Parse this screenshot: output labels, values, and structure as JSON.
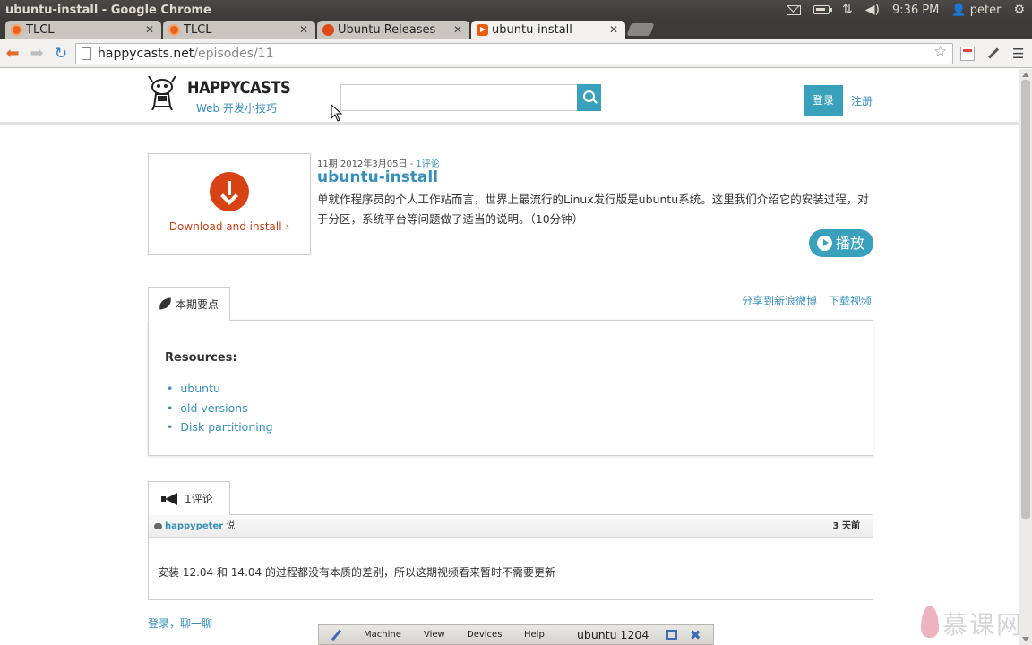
{
  "panel": {
    "window_title": "ubuntu-install - Google Chrome",
    "clock": "9:36 PM",
    "user": "peter"
  },
  "tabs": [
    {
      "label": "TLCL",
      "favicon": "tlcl-icon"
    },
    {
      "label": "TLCL",
      "favicon": "tlcl-icon"
    },
    {
      "label": "Ubuntu Releases",
      "favicon": "ubuntu-icon"
    },
    {
      "label": "ubuntu-install",
      "favicon": "video-icon",
      "active": true
    }
  ],
  "toolbar": {
    "url_domain": "happycasts.net",
    "url_path": "/episodes/11"
  },
  "site": {
    "logo_name": "HAPPYCASTS",
    "logo_tagline": "Web 开发小技巧",
    "search_placeholder": "",
    "login_label": "登录",
    "register_label": "注册"
  },
  "episode": {
    "meta_prefix": "11期 2012年3月05日 - ",
    "meta_comments": "1评论",
    "title": "ubuntu-install",
    "description": "单就作程序员的个人工作站而言，世界上最流行的Linux发行版是ubuntu系统。这里我们介绍它的安装过程，对于分区，系统平台等问题做了适当的说明。（10分钟）",
    "download_label": "Download and install ›",
    "play_label": "播放"
  },
  "highlights": {
    "tab_label": "本期要点",
    "share_label": "分享到新浪微博",
    "download_video_label": "下载视频",
    "resources_heading": "Resources:",
    "resources": [
      "ubuntu",
      "old versions",
      "Disk partitioning"
    ]
  },
  "comments": {
    "tab_label": "1评论",
    "items": [
      {
        "author": "happypeter",
        "says": " 说",
        "time": "3 天前",
        "body": "安装 12.04 和 14.04 的过程都没有本质的差别，所以这期视频看来暂时不需要更新"
      }
    ],
    "login_chat_label": "登录，聊一聊"
  },
  "vbox": {
    "menu": [
      "Machine",
      "View",
      "Devices",
      "Help"
    ],
    "title": "ubuntu 1204"
  },
  "watermark": {
    "text": "慕课网"
  },
  "colors": {
    "accent": "#3aa1bd",
    "link": "#3a8fb7",
    "download": "#d84315"
  }
}
